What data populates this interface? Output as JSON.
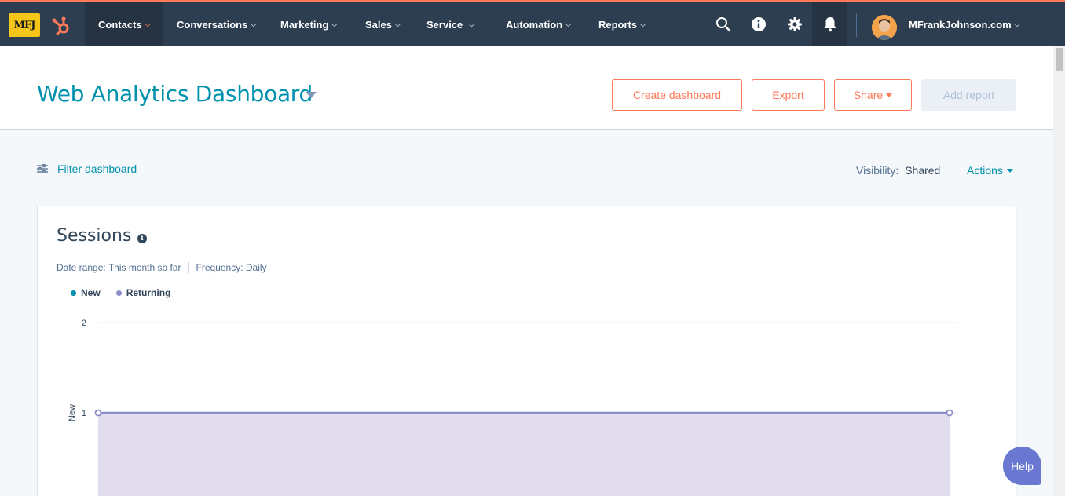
{
  "brand": {
    "logo_text": "MFJ",
    "accent": "#ff7a59",
    "nav_bg": "#2d3e50"
  },
  "nav": {
    "items": [
      {
        "label": "Contacts"
      },
      {
        "label": "Conversations"
      },
      {
        "label": "Marketing"
      },
      {
        "label": "Sales"
      },
      {
        "label": "Service"
      },
      {
        "label": "Automation"
      },
      {
        "label": "Reports"
      }
    ],
    "icons": [
      "search-icon",
      "info-icon",
      "gear-icon",
      "bell-icon"
    ],
    "account": "MFrankJohnson.com"
  },
  "header": {
    "title": "Web Analytics Dashboard",
    "buttons": {
      "create": "Create dashboard",
      "export": "Export",
      "share": "Share",
      "add_report": "Add report"
    }
  },
  "toolbar": {
    "filter": "Filter dashboard",
    "visibility_label": "Visibility:",
    "visibility_value": "Shared",
    "actions": "Actions"
  },
  "card": {
    "title": "Sessions",
    "date_range": "Date range: This month so far",
    "frequency": "Frequency: Daily",
    "legend": [
      {
        "name": "New",
        "color": "#0091ae"
      },
      {
        "name": "Returning",
        "color": "#8d8dc8"
      }
    ]
  },
  "chart_data": {
    "type": "area",
    "ylabel": "New",
    "y_ticks": [
      "2",
      "1"
    ],
    "ylim": [
      0,
      2
    ],
    "series": [
      {
        "name": "Returning",
        "values": [
          1,
          1
        ]
      }
    ]
  },
  "help": {
    "label": "Help"
  }
}
